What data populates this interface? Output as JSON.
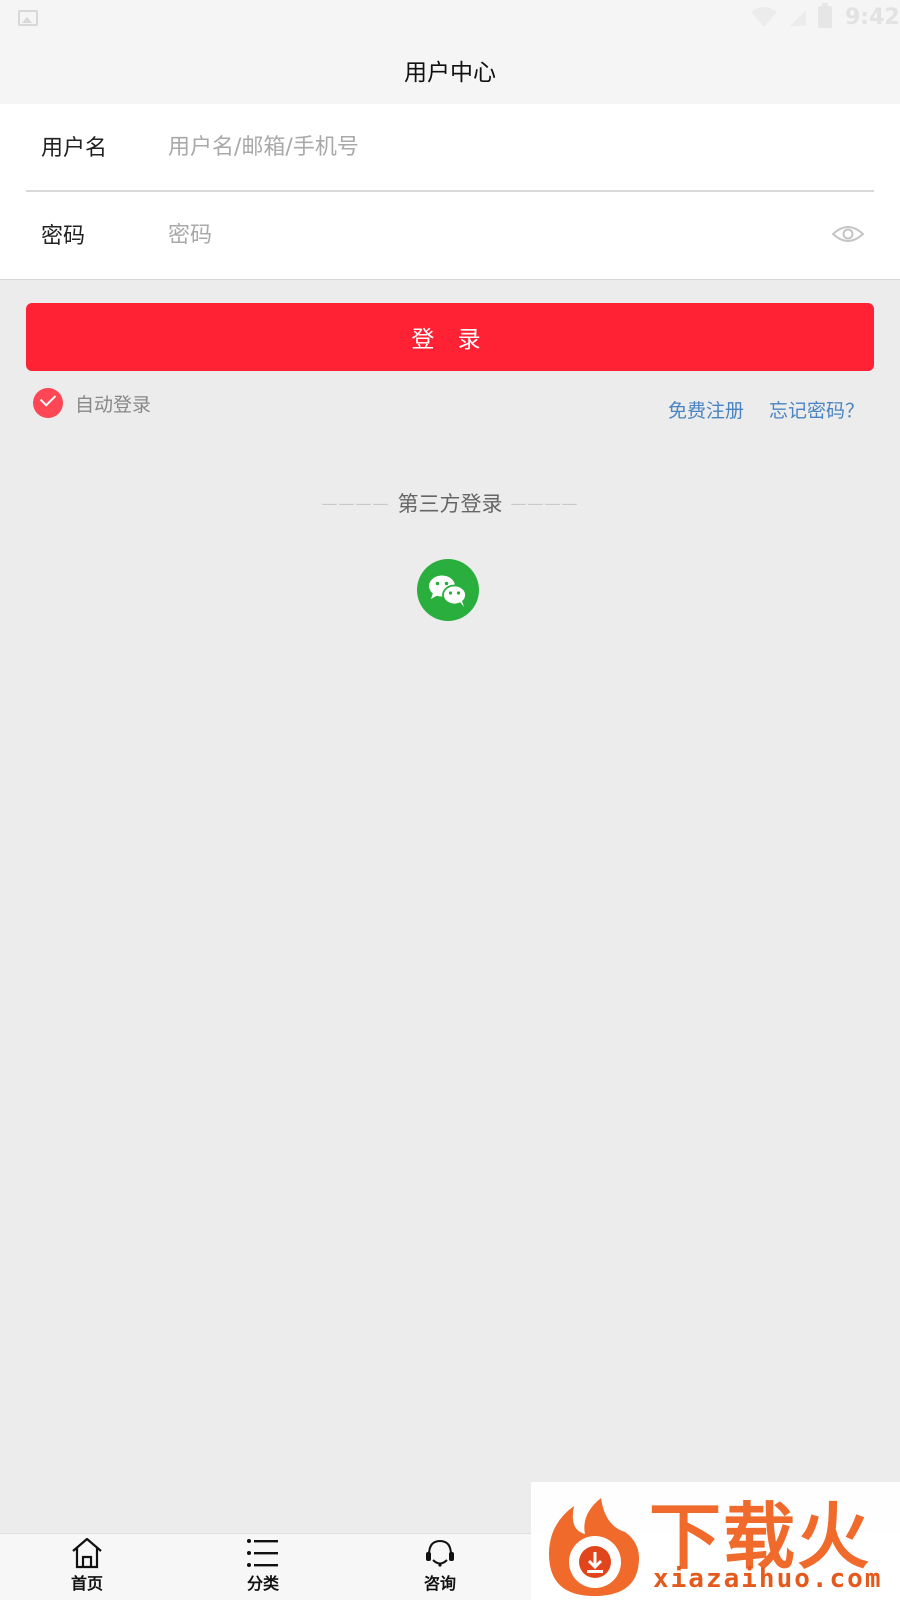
{
  "status_bar": {
    "time": "9:42"
  },
  "header": {
    "title": "用户中心"
  },
  "form": {
    "username": {
      "label": "用户名",
      "placeholder": "用户名/邮箱/手机号",
      "value": ""
    },
    "password": {
      "label": "密码",
      "placeholder": "密码",
      "value": ""
    }
  },
  "login_button_label": "登 录",
  "auto_login": {
    "label": "自动登录",
    "checked": true
  },
  "links": {
    "register": "免费注册",
    "forgot_password": "忘记密码？"
  },
  "third_party": {
    "dash_left": "————",
    "title": "第三方登录",
    "dash_right": "————"
  },
  "bottom_nav": [
    {
      "label": "首页",
      "icon": "home-icon"
    },
    {
      "label": "分类",
      "icon": "list-icon"
    },
    {
      "label": "咨询",
      "icon": "headset-icon"
    }
  ],
  "watermark": {
    "brand": "下载火",
    "domain": "xiazaihuo.com"
  },
  "colors": {
    "accent": "#ff2235",
    "link": "#4a84c2",
    "wechat": "#2aae3e"
  }
}
